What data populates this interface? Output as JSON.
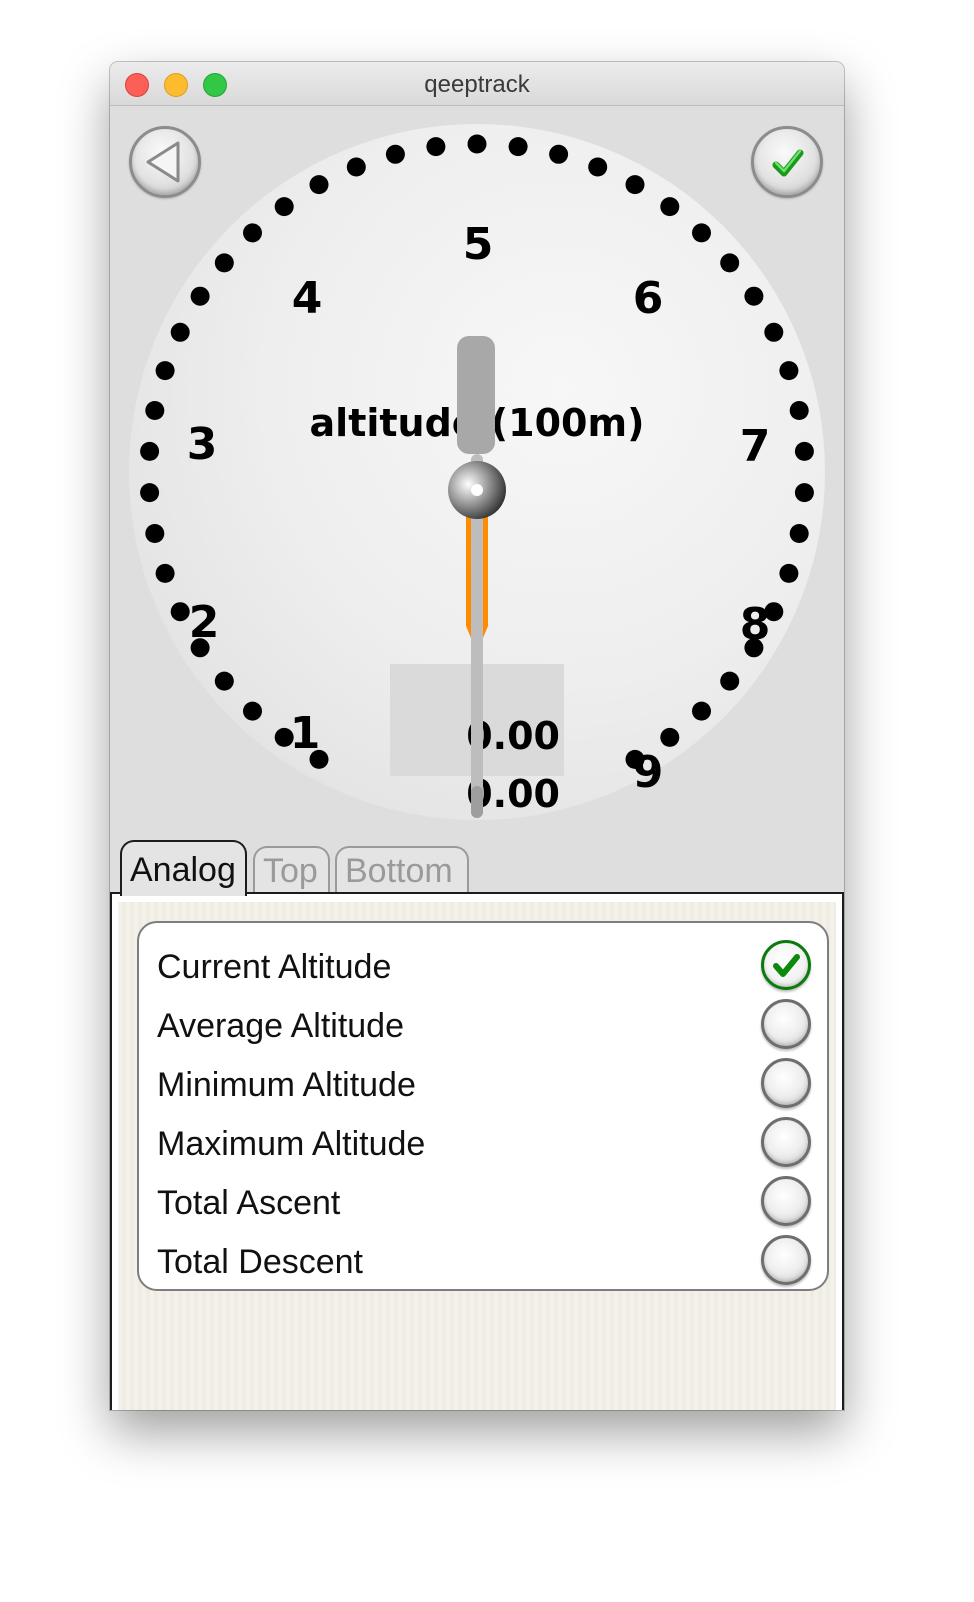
{
  "window": {
    "title": "qeeptrack"
  },
  "dial": {
    "label": "altitude (100m)",
    "numbers": [
      "1",
      "2",
      "3",
      "4",
      "5",
      "6",
      "7",
      "8",
      "9"
    ],
    "readout": [
      "0.00",
      "0.00"
    ],
    "accent_color": "#ff8c00"
  },
  "toolbar": {
    "back_icon": "back-triangle-icon",
    "confirm_icon": "green-check-icon"
  },
  "tabs": [
    {
      "label": "Analog",
      "active": true
    },
    {
      "label": "Top",
      "active": false
    },
    {
      "label": "Bottom",
      "active": false
    }
  ],
  "options": [
    {
      "label": "Current Altitude",
      "checked": true
    },
    {
      "label": "Average Altitude",
      "checked": false
    },
    {
      "label": "Minimum Altitude",
      "checked": false
    },
    {
      "label": "Maximum Altitude",
      "checked": false
    },
    {
      "label": "Total Ascent",
      "checked": false
    },
    {
      "label": "Total Descent",
      "checked": false
    }
  ]
}
